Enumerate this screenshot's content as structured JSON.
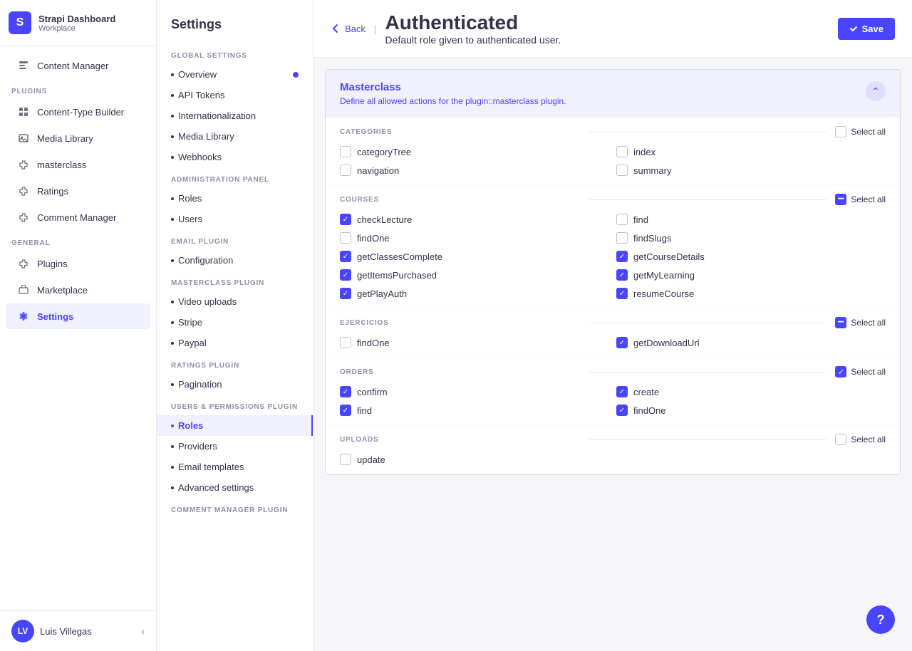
{
  "app": {
    "title": "Strapi Dashboard",
    "subtitle": "Workplace",
    "logo_initials": "S"
  },
  "sidebar": {
    "nav_items": [
      {
        "id": "content-manager",
        "label": "Content Manager",
        "icon": "content-icon",
        "active": false
      },
      {
        "id": "plugins-label",
        "type": "section",
        "label": "PLUGINS"
      },
      {
        "id": "content-type-builder",
        "label": "Content-Type Builder",
        "icon": "builder-icon",
        "active": false
      },
      {
        "id": "media-library",
        "label": "Media Library",
        "icon": "media-icon",
        "active": false
      },
      {
        "id": "masterclass",
        "label": "masterclass",
        "icon": "puzzle-icon",
        "active": false
      },
      {
        "id": "ratings",
        "label": "Ratings",
        "icon": "puzzle-icon",
        "active": false
      },
      {
        "id": "comment-manager",
        "label": "Comment Manager",
        "icon": "puzzle-icon",
        "active": false
      },
      {
        "id": "general-label",
        "type": "section",
        "label": "GENERAL"
      },
      {
        "id": "plugins",
        "label": "Plugins",
        "icon": "puzzle-icon",
        "active": false
      },
      {
        "id": "marketplace",
        "label": "Marketplace",
        "icon": "marketplace-icon",
        "active": false
      },
      {
        "id": "settings",
        "label": "Settings",
        "icon": "gear-icon",
        "active": true
      }
    ],
    "user": {
      "name": "Luis Villegas",
      "initials": "LV"
    }
  },
  "settings_panel": {
    "title": "Settings",
    "sections": [
      {
        "label": "GLOBAL SETTINGS",
        "items": [
          {
            "id": "overview",
            "label": "Overview",
            "active": false,
            "has_dot": true
          },
          {
            "id": "api-tokens",
            "label": "API Tokens",
            "active": false
          },
          {
            "id": "internationalization",
            "label": "Internationalization",
            "active": false
          },
          {
            "id": "media-library",
            "label": "Media Library",
            "active": false
          },
          {
            "id": "webhooks",
            "label": "Webhooks",
            "active": false
          }
        ]
      },
      {
        "label": "ADMINISTRATION PANEL",
        "items": [
          {
            "id": "roles",
            "label": "Roles",
            "active": false
          },
          {
            "id": "users",
            "label": "Users",
            "active": false
          }
        ]
      },
      {
        "label": "EMAIL PLUGIN",
        "items": [
          {
            "id": "configuration",
            "label": "Configuration",
            "active": false
          }
        ]
      },
      {
        "label": "MASTERCLASS PLUGIN",
        "items": [
          {
            "id": "video-uploads",
            "label": "Video uploads",
            "active": false
          },
          {
            "id": "stripe",
            "label": "Stripe",
            "active": false
          },
          {
            "id": "paypal",
            "label": "Paypal",
            "active": false
          }
        ]
      },
      {
        "label": "RATINGS PLUGIN",
        "items": [
          {
            "id": "pagination",
            "label": "Pagination",
            "active": false
          }
        ]
      },
      {
        "label": "USERS & PERMISSIONS PLUGIN",
        "items": [
          {
            "id": "roles-up",
            "label": "Roles",
            "active": true
          },
          {
            "id": "providers",
            "label": "Providers",
            "active": false
          },
          {
            "id": "email-templates",
            "label": "Email templates",
            "active": false
          },
          {
            "id": "advanced-settings",
            "label": "Advanced settings",
            "active": false
          }
        ]
      },
      {
        "label": "COMMENT MANAGER PLUGIN",
        "items": []
      }
    ]
  },
  "header": {
    "back_label": "Back",
    "title": "Authenticated",
    "subtitle": "Default role given to authenticated user.",
    "save_label": "Save"
  },
  "plugin": {
    "name": "Masterclass",
    "description": "Define all allowed actions for the plugin::masterclass plugin."
  },
  "permissions": {
    "categories": {
      "label": "CATEGORIES",
      "select_all_label": "Select all",
      "select_all_state": "unchecked",
      "items": [
        {
          "id": "cat-categoryTree",
          "label": "categoryTree",
          "checked": false
        },
        {
          "id": "cat-index",
          "label": "index",
          "checked": false
        },
        {
          "id": "cat-navigation",
          "label": "navigation",
          "checked": false
        },
        {
          "id": "cat-summary",
          "label": "summary",
          "checked": false
        }
      ]
    },
    "courses": {
      "label": "COURSES",
      "select_all_label": "Select all",
      "select_all_state": "indeterminate",
      "items": [
        {
          "id": "crs-checkLecture",
          "label": "checkLecture",
          "checked": true
        },
        {
          "id": "crs-find",
          "label": "find",
          "checked": false
        },
        {
          "id": "crs-findOne",
          "label": "findOne",
          "checked": false
        },
        {
          "id": "crs-findSlugs",
          "label": "findSlugs",
          "checked": false
        },
        {
          "id": "crs-getClassesComplete",
          "label": "getClassesComplete",
          "checked": true
        },
        {
          "id": "crs-getCourseDetails",
          "label": "getCourseDetails",
          "checked": true
        },
        {
          "id": "crs-getItemsPurchased",
          "label": "getItemsPurchased",
          "checked": true
        },
        {
          "id": "crs-getMyLearning",
          "label": "getMyLearning",
          "checked": true
        },
        {
          "id": "crs-getPlayAuth",
          "label": "getPlayAuth",
          "checked": true
        },
        {
          "id": "crs-resumeCourse",
          "label": "resumeCourse",
          "checked": true
        }
      ]
    },
    "ejercicios": {
      "label": "EJERCICIOS",
      "select_all_label": "Select all",
      "select_all_state": "indeterminate",
      "items": [
        {
          "id": "ej-findOne",
          "label": "findOne",
          "checked": false
        },
        {
          "id": "ej-getDownloadUrl",
          "label": "getDownloadUrl",
          "checked": true
        }
      ]
    },
    "orders": {
      "label": "ORDERS",
      "select_all_label": "Select all",
      "select_all_state": "checked",
      "items": [
        {
          "id": "ord-confirm",
          "label": "confirm",
          "checked": true
        },
        {
          "id": "ord-create",
          "label": "create",
          "checked": true
        },
        {
          "id": "ord-find",
          "label": "find",
          "checked": true
        },
        {
          "id": "ord-findOne",
          "label": "findOne",
          "checked": true
        }
      ]
    },
    "uploads": {
      "label": "UPLOADS",
      "select_all_label": "Select all",
      "select_all_state": "unchecked",
      "items": [
        {
          "id": "up-update",
          "label": "update",
          "checked": false
        }
      ]
    }
  }
}
